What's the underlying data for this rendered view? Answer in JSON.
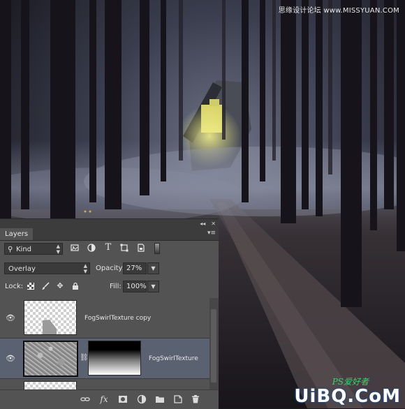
{
  "watermarks": {
    "top": "思缘设计论坛 www.MISSYUAN.COM",
    "bottom_logo": "UiBQ.CoM",
    "bottom_ps": "PS爱好者"
  },
  "panel": {
    "tab_label": "Layers",
    "collapse_glyph": "◂◂",
    "close_glyph": "✕",
    "menu_glyph": "▾≡",
    "filter": {
      "kind_label": "Kind",
      "kind_icon": "search-icon",
      "filter_icons": [
        "image-filter-icon",
        "adjustment-filter-icon",
        "type-filter-icon",
        "shape-filter-icon",
        "smart-object-filter-icon"
      ]
    },
    "blend_mode": "Overlay",
    "opacity_label": "Opacity:",
    "opacity_value": "27%",
    "lock_label": "Lock:",
    "fill_label": "Fill:",
    "fill_value": "100%",
    "layers": [
      {
        "name": "FogSwirlTexture copy",
        "visible": true,
        "selected": false,
        "has_mask": false
      },
      {
        "name": "FogSwirlTexture",
        "visible": true,
        "selected": true,
        "has_mask": true
      }
    ],
    "bottom_icons": [
      "link-layers-icon",
      "fx-icon",
      "add-mask-icon",
      "adjustment-layer-icon",
      "new-group-icon",
      "new-layer-icon",
      "delete-layer-icon"
    ],
    "fx_label": "fx"
  },
  "colors": {
    "panel_bg": "#535353",
    "selected_row": "#5a6272",
    "window_glow": "#d8d46a"
  }
}
